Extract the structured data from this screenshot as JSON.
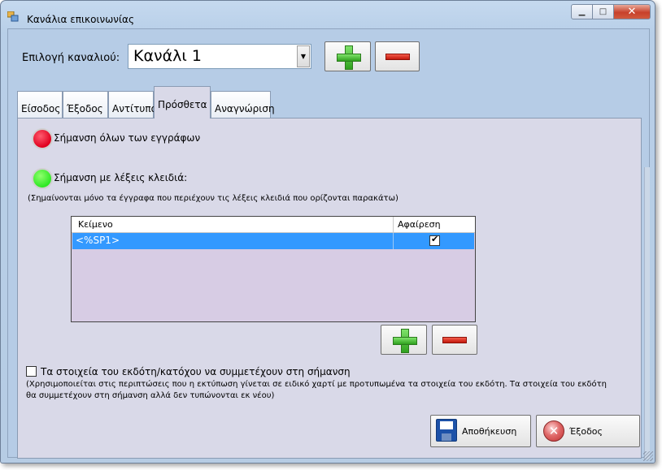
{
  "window": {
    "title": "Κανάλια επικοινωνίας",
    "minimize_glyph": "▁",
    "maximize_glyph": "□",
    "close_glyph": "✕"
  },
  "channel": {
    "label": "Επιλογή καναλιού:",
    "selected": "Κανάλι 1"
  },
  "tabs": [
    {
      "label": "Είσοδος"
    },
    {
      "label": "Έξοδος"
    },
    {
      "label": "Αντίτυπα"
    },
    {
      "label": "Πρόσθετα"
    },
    {
      "label": "Αναγνώριση"
    }
  ],
  "active_tab": "Πρόσθετα",
  "marking": {
    "all_label": "Σήμανση όλων των εγγράφων",
    "keywords_label": "Σήμανση με λέξεις κλειδιά:",
    "keywords_note": "(Σημαίνονται μόνο τα έγγραφα που περιέχουν τις λέξεις κλειδιά που ορίζονται παρακάτω)"
  },
  "grid": {
    "columns": [
      "Κείμενο",
      "Αφαίρεση"
    ],
    "rows": [
      {
        "text": "<%SP1>",
        "remove": true
      }
    ]
  },
  "publisher": {
    "checkbox_label": "Τα στοιχεία του εκδότη/κατόχου να συμμετέχουν στη σήμανση",
    "note_line1": "(Χρησιμοποιείται στις περιπτώσεις που η εκτύπωση γίνεται σε ειδικό χαρτί με προτυπωμένα τα στοιχεία του εκδότη. Τα στοιχεία του εκδότη",
    "note_line2": "θα συμμετέχουν στη σήμανση αλλά δεν τυπώνονται εκ νέου)",
    "checked": false
  },
  "buttons": {
    "save": "Αποθήκευση",
    "exit": "Έξοδος"
  },
  "colors": {
    "selection": "#3399ff",
    "page_bg": "#d9d9e8",
    "grid_bg": "#d7cce4",
    "window_bg": "#b6cce6"
  },
  "icons": {
    "add": "plus-icon",
    "remove": "minus-icon",
    "save": "floppy-disk-icon",
    "exit": "close-circle-icon"
  }
}
